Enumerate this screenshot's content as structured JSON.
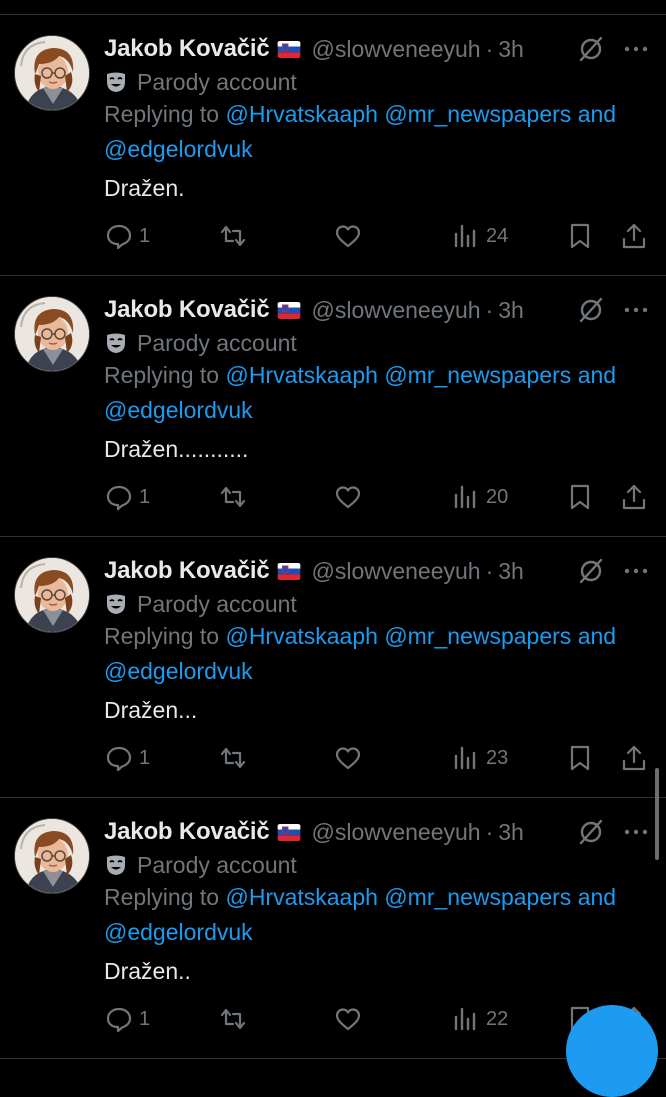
{
  "colors": {
    "background": "#000000",
    "link": "#1d9bf0",
    "muted": "#71767b",
    "text": "#e7e9ea",
    "divider": "#2f3336"
  },
  "tweets": [
    {
      "display_name": "Jakob Kovačič",
      "handle": "@slowveneeyuh",
      "separator": "·",
      "time": "3h",
      "parody_label": "Parody account",
      "replying_prefix": "Replying to",
      "mention_1": "@Hrvatskaaph",
      "mention_2": "@mr_newspapers",
      "and_word": "and",
      "mention_3": "@edgelordvuk",
      "text": "Dražen.",
      "replies": "1",
      "views": "24",
      "icons": [
        "comment-icon",
        "repost-icon",
        "heart-icon",
        "views-icon",
        "bookmark-icon",
        "share-icon",
        "grok-icon",
        "more-icon",
        "mask-icon",
        "slovenia-flag-icon"
      ]
    },
    {
      "display_name": "Jakob Kovačič",
      "handle": "@slowveneeyuh",
      "separator": "·",
      "time": "3h",
      "parody_label": "Parody account",
      "replying_prefix": "Replying to",
      "mention_1": "@Hrvatskaaph",
      "mention_2": "@mr_newspapers",
      "and_word": "and",
      "mention_3": "@edgelordvuk",
      "text": "Dražen...........",
      "replies": "1",
      "views": "20"
    },
    {
      "display_name": "Jakob Kovačič",
      "handle": "@slowveneeyuh",
      "separator": "·",
      "time": "3h",
      "parody_label": "Parody account",
      "replying_prefix": "Replying to",
      "mention_1": "@Hrvatskaaph",
      "mention_2": "@mr_newspapers",
      "and_word": "and",
      "mention_3": "@edgelordvuk",
      "text": "Dražen...",
      "replies": "1",
      "views": "23"
    },
    {
      "display_name": "Jakob Kovačič",
      "handle": "@slowveneeyuh",
      "separator": "·",
      "time": "3h",
      "parody_label": "Parody account",
      "replying_prefix": "Replying to",
      "mention_1": "@Hrvatskaaph",
      "mention_2": "@mr_newspapers",
      "and_word": "and",
      "mention_3": "@edgelordvuk",
      "text": "Dražen..",
      "replies": "1",
      "views": "22"
    }
  ]
}
